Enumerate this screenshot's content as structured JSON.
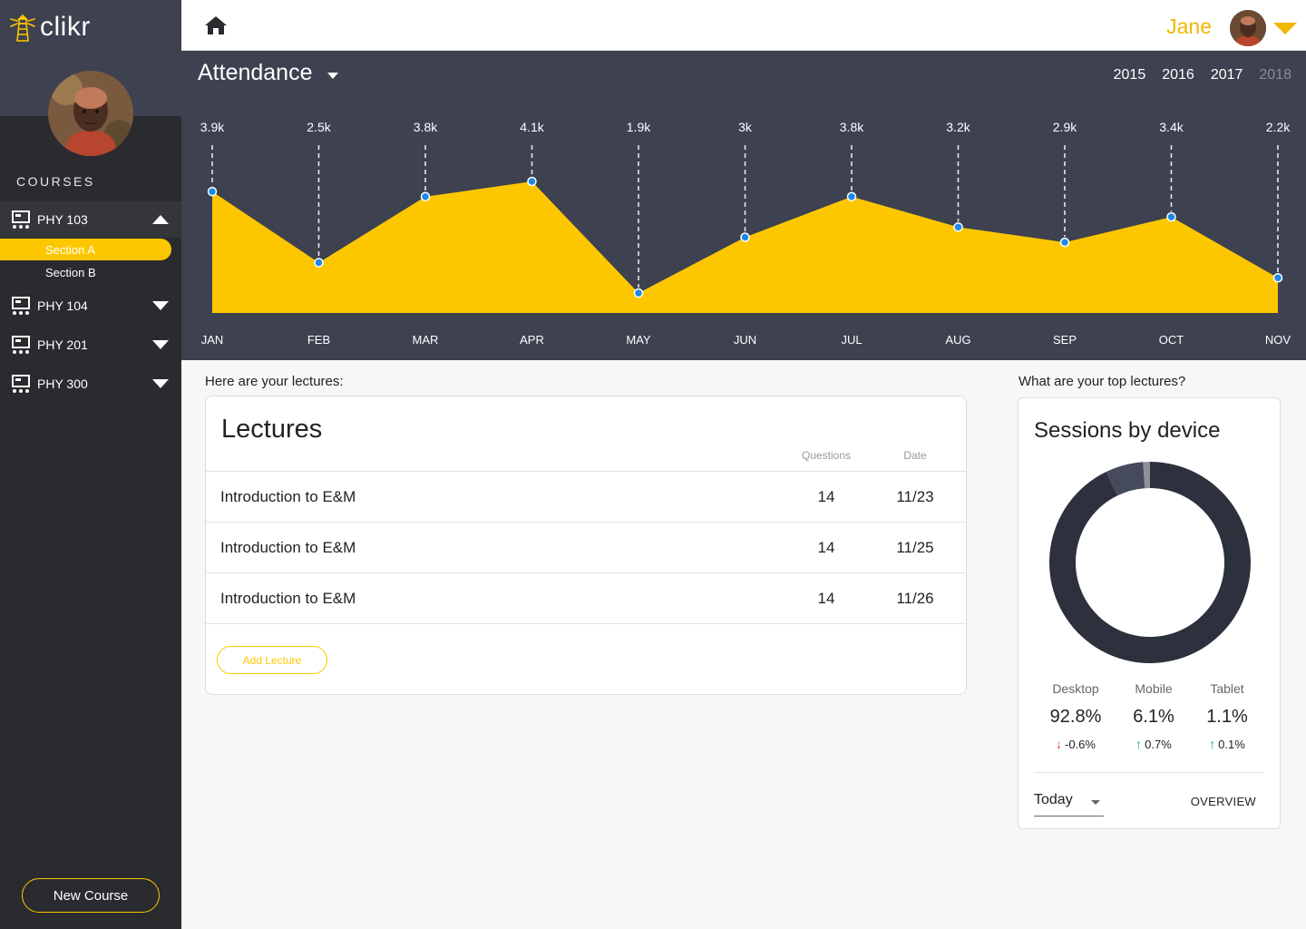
{
  "app": {
    "logo_text": "clikr"
  },
  "sidebar": {
    "courses_label": "COURSES",
    "courses": [
      {
        "name": "PHY 103",
        "expanded": true,
        "sections": [
          "Section A",
          "Section B"
        ],
        "selected_section": "Section A"
      },
      {
        "name": "PHY 104",
        "expanded": false
      },
      {
        "name": "PHY 201",
        "expanded": false
      },
      {
        "name": "PHY 300",
        "expanded": false
      }
    ],
    "new_course_label": "New Course"
  },
  "header": {
    "user_name": "Jane"
  },
  "attendance": {
    "title": "Attendance",
    "years": [
      "2015",
      "2016",
      "2017",
      "2018"
    ],
    "active_years": [
      "2015",
      "2016",
      "2017"
    ],
    "inactive_year": "2018"
  },
  "chart_data": {
    "type": "area",
    "categories": [
      "JAN",
      "FEB",
      "MAR",
      "APR",
      "MAY",
      "JUN",
      "JUL",
      "AUG",
      "SEP",
      "OCT",
      "NOV"
    ],
    "value_labels": [
      "3.9k",
      "2.5k",
      "3.8k",
      "4.1k",
      "1.9k",
      "3k",
      "3.8k",
      "3.2k",
      "2.9k",
      "3.4k",
      "2.2k"
    ],
    "values": [
      3900,
      2500,
      3800,
      4100,
      1900,
      3000,
      3800,
      3200,
      2900,
      3400,
      2200
    ],
    "title": "Attendance",
    "fill_color": "#fdc700",
    "point_color": "#1e88e5"
  },
  "lectures": {
    "caption": "Here are your lectures:",
    "title": "Lectures",
    "columns": {
      "questions": "Questions",
      "date": "Date"
    },
    "rows": [
      {
        "name": "Introduction to E&M",
        "questions": "14",
        "date": "11/23"
      },
      {
        "name": "Introduction to E&M",
        "questions": "14",
        "date": "11/25"
      },
      {
        "name": "Introduction to E&M",
        "questions": "14",
        "date": "11/26"
      }
    ],
    "add_label": "Add Lecture"
  },
  "sessions": {
    "caption": "What are your top lectures?",
    "title": "Sessions by device",
    "devices": [
      {
        "name": "Desktop",
        "pct": "92.8%",
        "value": 92.8,
        "change": "-0.6%",
        "trend": "down",
        "color": "#2d303d"
      },
      {
        "name": "Mobile",
        "pct": "6.1%",
        "value": 6.1,
        "change": "0.7%",
        "trend": "up",
        "color": "#454a5c"
      },
      {
        "name": "Tablet",
        "pct": "1.1%",
        "value": 1.1,
        "change": "0.1%",
        "trend": "up",
        "color": "#8e919b"
      }
    ],
    "period": "Today",
    "overview_label": "OVERVIEW"
  },
  "colors": {
    "accent": "#fdc700",
    "sidebar": "#2a2b2e",
    "panel": "#3d4150"
  }
}
